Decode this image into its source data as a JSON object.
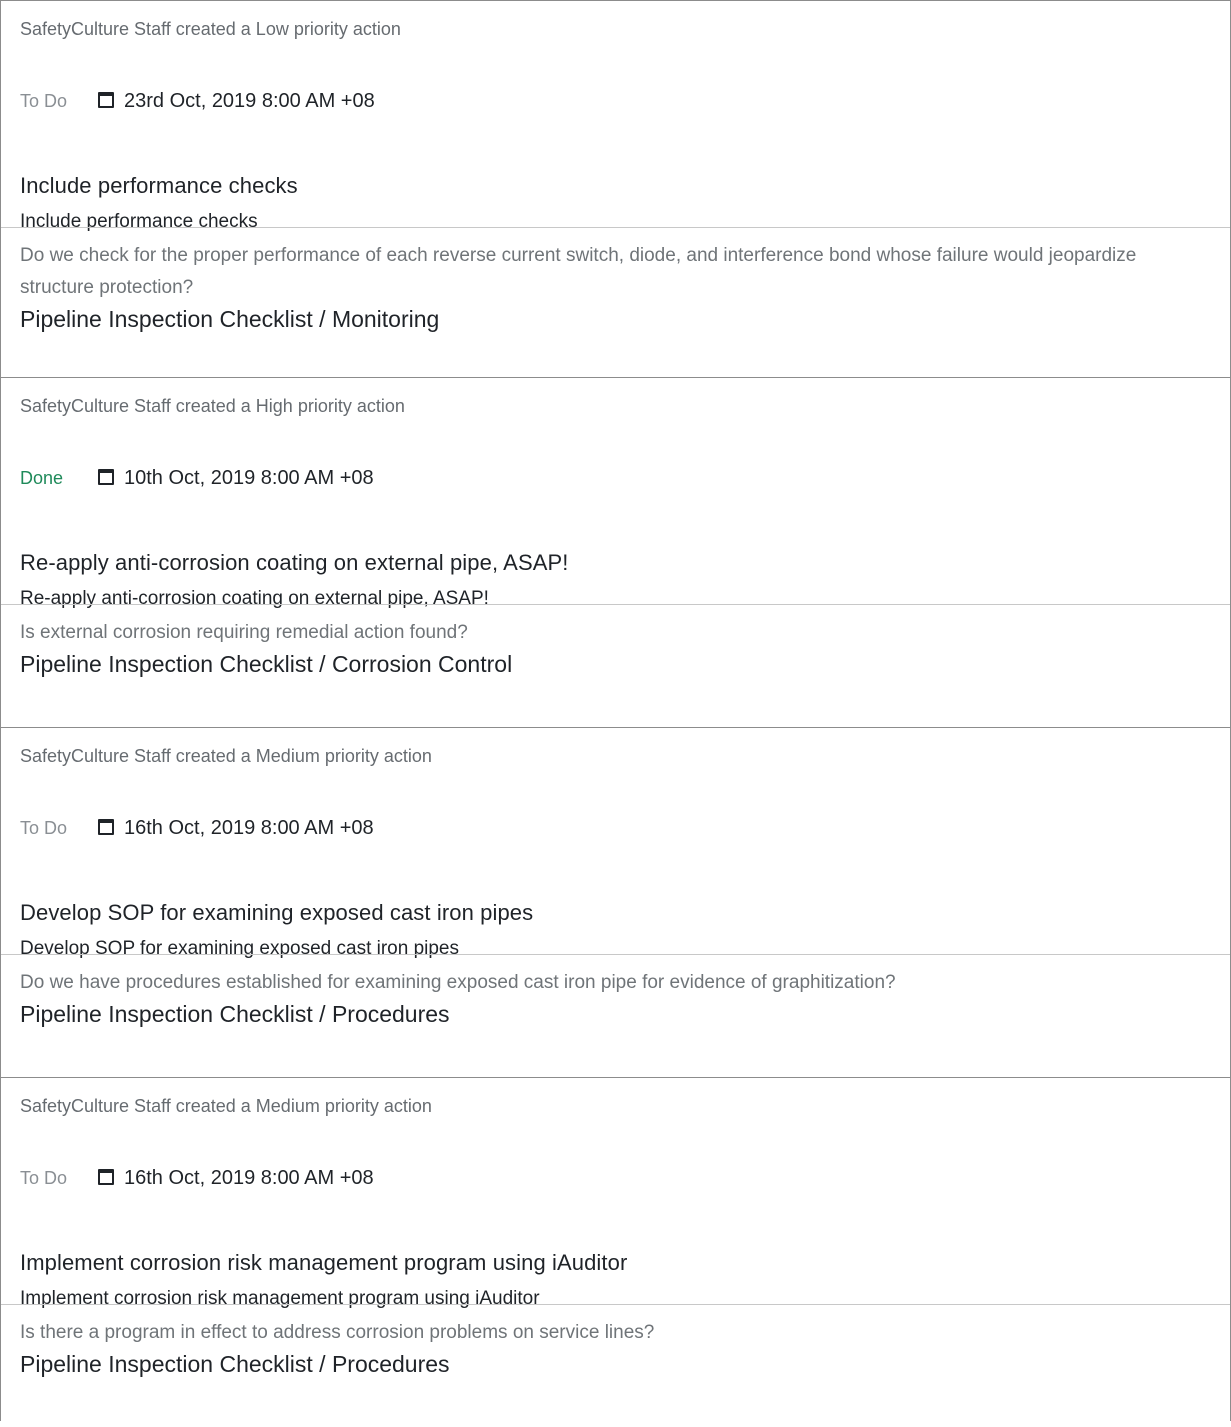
{
  "actions": [
    {
      "creator": "SafetyCulture Staff created a Low priority action",
      "status": "To Do",
      "status_kind": "todo",
      "due": "23rd Oct, 2019 8:00 AM +08",
      "title": "Include performance checks",
      "description": "Include performance checks",
      "question": "Do we check for the proper performance of each reverse current switch, diode, and interference bond whose failure would jeopardize structure protection?",
      "source": "Pipeline Inspection Checklist / Monitoring"
    },
    {
      "creator": "SafetyCulture Staff created a High priority action",
      "status": "Done",
      "status_kind": "done",
      "due": "10th Oct, 2019 8:00 AM +08",
      "title": "Re-apply anti-corrosion coating on external pipe, ASAP!",
      "description": "Re-apply anti-corrosion coating on external pipe, ASAP!",
      "question": "Is external corrosion requiring remedial action found?",
      "source": "Pipeline Inspection Checklist / Corrosion Control"
    },
    {
      "creator": "SafetyCulture Staff created a Medium priority action",
      "status": "To Do",
      "status_kind": "todo",
      "due": "16th Oct, 2019 8:00 AM +08",
      "title": "Develop SOP for examining exposed cast iron pipes",
      "description": "Develop SOP for examining exposed cast iron pipes",
      "question": "Do we have procedures established for examining exposed cast iron pipe for evidence of graphitization?",
      "source": "Pipeline Inspection Checklist / Procedures"
    },
    {
      "creator": "SafetyCulture Staff created a Medium priority action",
      "status": "To Do",
      "status_kind": "todo",
      "due": "16th Oct, 2019 8:00 AM +08",
      "title": "Implement corrosion risk management program using iAuditor",
      "description": "Implement corrosion risk management program using iAuditor",
      "question": "Is there a program in effect to address corrosion problems on service lines?",
      "source": "Pipeline Inspection Checklist / Procedures"
    }
  ],
  "colors": {
    "done": "#1f8a5a",
    "todo": "#8a8f94",
    "text": "#1f2328",
    "muted": "#6f7478"
  },
  "icons": {
    "due": "calendar-icon"
  }
}
